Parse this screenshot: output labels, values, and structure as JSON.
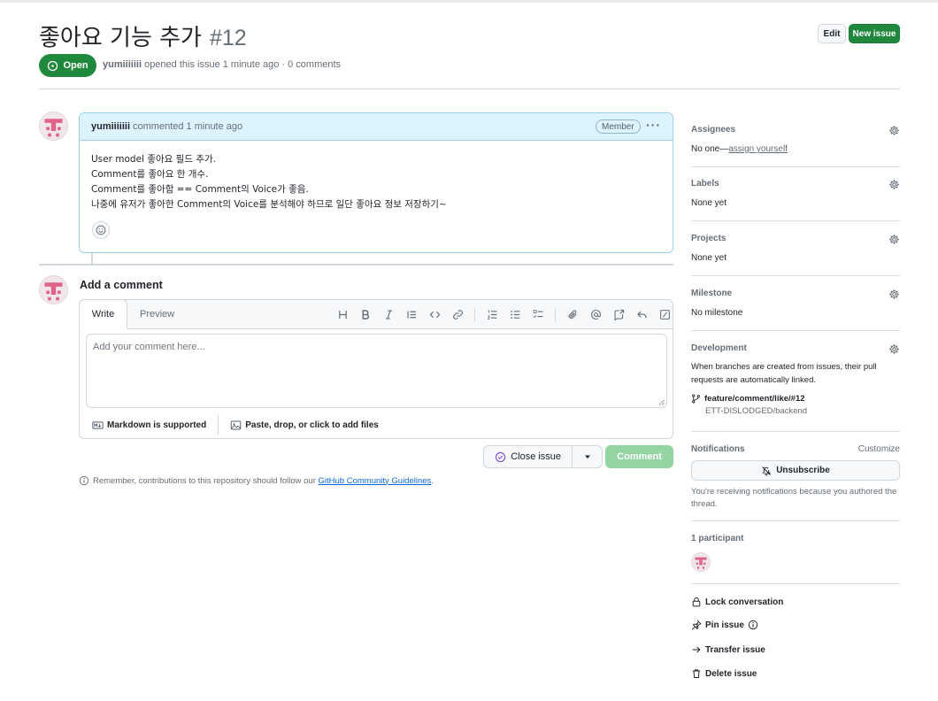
{
  "issue": {
    "title": "좋아요 기능 추가",
    "number": "#12",
    "state": "Open",
    "author": "yumiiiiiii",
    "meta_rest": " opened this issue 1 minute ago · 0 comments",
    "edit_label": "Edit",
    "new_issue_label": "New issue"
  },
  "comment": {
    "author": "yumiiiiiii",
    "when": "commented 1 minute ago",
    "badge": "Member",
    "more": "···",
    "lines": [
      "User model 좋아요 필드 추가.",
      "Comment를 좋아요 한 개수.",
      "Comment를 좋아함 == Comment의 Voice가 좋음.",
      "나중에 유저가 좋아한 Comment의 Voice를 분석해야 하므로 일단 좋아요 정보 저장하기~"
    ]
  },
  "composer": {
    "title": "Add a comment",
    "tab_write": "Write",
    "tab_preview": "Preview",
    "placeholder": "Add your comment here...",
    "markdown_label": "Markdown is supported",
    "attach_label": "Paste, drop, or click to add files",
    "close_label": "Close issue",
    "comment_label": "Comment",
    "guidelines_prefix": "Remember, contributions to this repository should follow our ",
    "guidelines_link": "GitHub Community Guidelines",
    "guidelines_suffix": "."
  },
  "sidebar": {
    "assignees": {
      "label": "Assignees",
      "none": "No one—",
      "assign": "assign yourself"
    },
    "labels": {
      "label": "Labels",
      "value": "None yet"
    },
    "projects": {
      "label": "Projects",
      "value": "None yet"
    },
    "milestone": {
      "label": "Milestone",
      "value": "No milestone"
    },
    "development": {
      "label": "Development",
      "desc": "When branches are created from issues, their pull requests are automatically linked.",
      "branch": "feature/comment/like/#12",
      "repo": "ETT-DISLODGED/backend"
    },
    "notifications": {
      "label": "Notifications",
      "customize": "Customize",
      "unsubscribe": "Unsubscribe",
      "desc": "You're receiving notifications because you authored the thread."
    },
    "participants": {
      "label": "1 participant"
    },
    "actions": {
      "lock": "Lock conversation",
      "pin": "Pin issue",
      "transfer": "Transfer issue",
      "delete": "Delete issue"
    }
  },
  "colors": {
    "open_green": "#1f883d",
    "comment_header": "#ddf4ff",
    "comment_disabled": "#94d3a2",
    "avatar_pink": "#e0648a"
  }
}
